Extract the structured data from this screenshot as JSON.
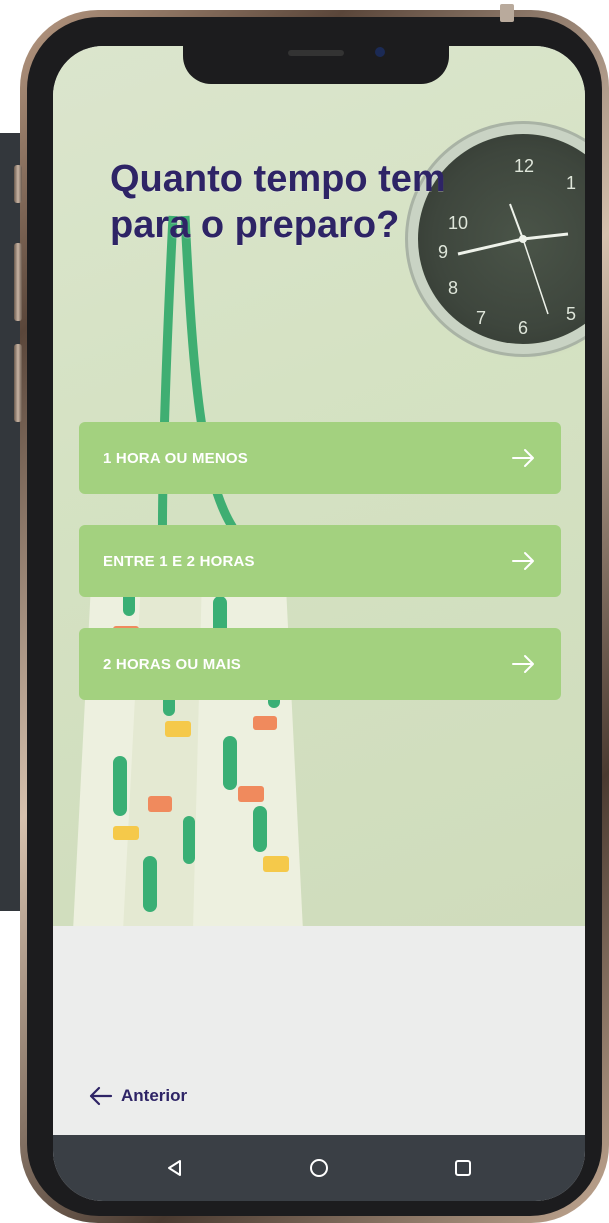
{
  "screen": {
    "title": "Quanto tempo tem para o preparo?",
    "options": [
      {
        "label": "1 HORA OU MENOS",
        "icon": "arrow-right-icon"
      },
      {
        "label": "ENTRE 1 E 2 HORAS",
        "icon": "arrow-right-icon"
      },
      {
        "label": "2 HORAS OU MAIS",
        "icon": "arrow-right-icon"
      }
    ],
    "previous": {
      "label": "Anterior",
      "icon": "arrow-left-icon"
    }
  },
  "navbar": {
    "buttons": [
      "back-triangle-icon",
      "home-circle-icon",
      "recents-square-icon"
    ]
  },
  "colors": {
    "accent_green": "#a3d17f",
    "title_purple": "#2e2466",
    "navbar": "#3a3f45",
    "hero_bg": "#d5e2c3"
  }
}
